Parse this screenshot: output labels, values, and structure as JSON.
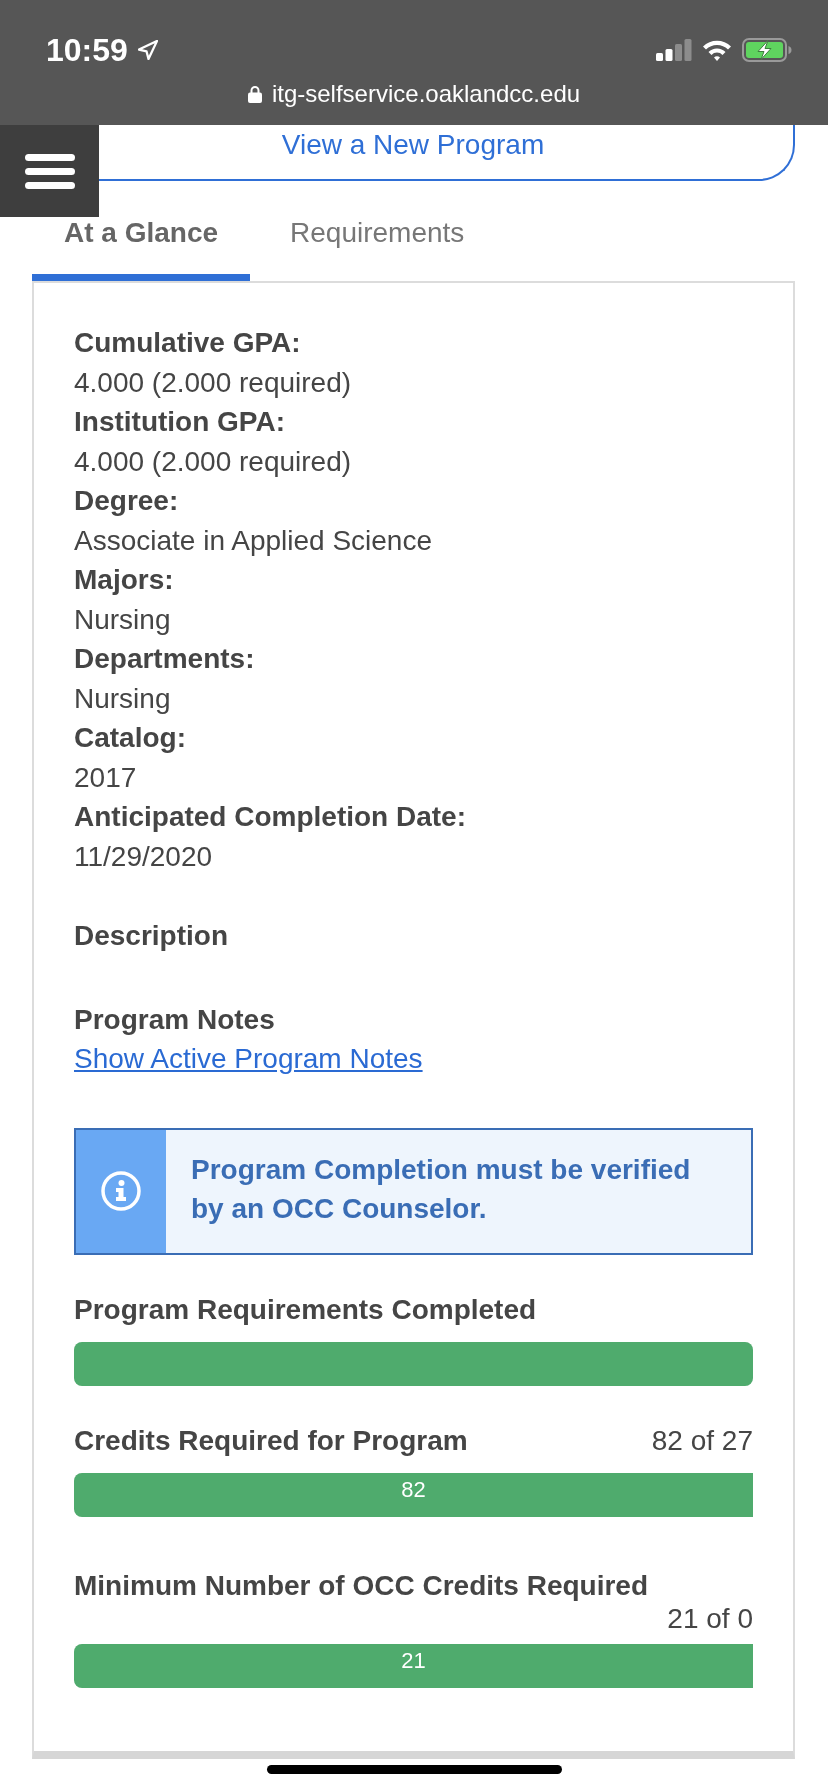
{
  "status_bar": {
    "time": "10:59"
  },
  "address_bar": {
    "url": "itg-selfservice.oaklandcc.edu"
  },
  "view_program_button": {
    "label": "View a New Program"
  },
  "tabs": [
    {
      "label": "At a Glance",
      "selected": true
    },
    {
      "label": "Requirements",
      "selected": false
    }
  ],
  "details": [
    {
      "label": "Cumulative GPA:",
      "value": "4.000 (2.000 required)"
    },
    {
      "label": "Institution GPA:",
      "value": "4.000 (2.000 required)"
    },
    {
      "label": "Degree:",
      "value": "Associate in Applied Science"
    },
    {
      "label": "Majors:",
      "value": "Nursing"
    },
    {
      "label": "Departments:",
      "value": "Nursing"
    },
    {
      "label": "Catalog:",
      "value": "2017"
    },
    {
      "label": "Anticipated Completion Date:",
      "value": "11/29/2020"
    }
  ],
  "description": {
    "heading": "Description"
  },
  "program_notes": {
    "heading": "Program Notes",
    "link": "Show Active Program Notes"
  },
  "notice": {
    "text": "Program Completion must be verified by an OCC Counselor."
  },
  "progress": [
    {
      "title": "Program Requirements Completed",
      "level": 1
    },
    {
      "title": "Credits Required for Program",
      "reading": "82 of 27",
      "bar_label": "82",
      "level": 1
    },
    {
      "title": "Minimum Number of OCC Credits Required",
      "reading": "21 of 0",
      "bar_label": "21",
      "level": 1
    }
  ]
}
